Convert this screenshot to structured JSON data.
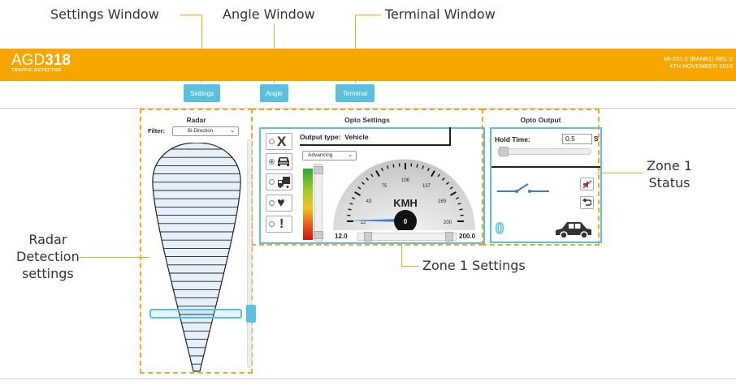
{
  "callouts": {
    "settings_window": "Settings Window",
    "angle_window": "Angle Window",
    "terminal_window": "Terminal Window",
    "zone1_status_line1": "Zone 1",
    "zone1_status_line2": "Status",
    "radar_detection_line1": "Radar",
    "radar_detection_line2": "Detection",
    "radar_detection_line3": "settings",
    "zone1_settings": "Zone 1 Settings"
  },
  "header": {
    "brand_light": "AGD",
    "brand_bold": "318",
    "subtitle": "TRAFFIC DETECTOR",
    "version_line1": "MI-201-2 (BANK1) REL-2",
    "version_line2": "4TH NOVEMBER 2019",
    "background_color": "#f7a600"
  },
  "nav": {
    "settings": "Settings",
    "angle": "Angle",
    "terminal": "Terminal",
    "accent_color": "#5bc0de"
  },
  "radar": {
    "title": "Radar",
    "filter_label": "Filter:",
    "filter_value": "Bi-Direction"
  },
  "opto_settings": {
    "title": "Opto Settings",
    "output_type_label": "Output type:",
    "output_type_value": "Vehicle",
    "direction_value": "Advancing",
    "type_buttons": [
      {
        "icon": "cross-icon",
        "glyph": "X",
        "selected": false
      },
      {
        "icon": "car-front-icon",
        "selected": true
      },
      {
        "icon": "truck-icon",
        "selected": false
      },
      {
        "icon": "heart-icon",
        "glyph": "♥",
        "selected": false
      },
      {
        "icon": "exclamation-icon",
        "glyph": "!",
        "selected": false
      }
    ],
    "gauge": {
      "unit": "KMH",
      "ticks": [
        "12",
        "43",
        "75",
        "106",
        "137",
        "169",
        "200"
      ],
      "reading": "0"
    },
    "speed_min": "12.0",
    "speed_max": "200.0"
  },
  "opto_output": {
    "title": "Opto Output",
    "hold_label": "Hold Time:",
    "hold_value": "0.5",
    "hold_unit": "S",
    "count": "0"
  }
}
